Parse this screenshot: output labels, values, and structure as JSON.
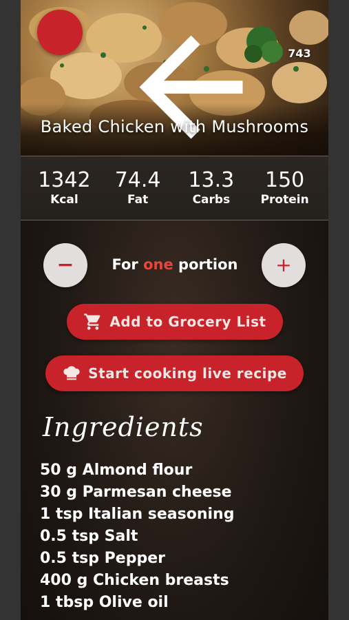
{
  "recipe": {
    "title": "Baked Chicken with Mushrooms",
    "likes": "743"
  },
  "icons": {
    "back": "arrow-left-icon",
    "favorite": "heart-icon",
    "cart": "cart-icon",
    "chef": "chef-hat-icon"
  },
  "nutrition": [
    {
      "value": "1342",
      "label": "Kcal"
    },
    {
      "value": "74.4",
      "label": "Fat"
    },
    {
      "value": "13.3",
      "label": "Carbs"
    },
    {
      "value": "150",
      "label": "Protein"
    }
  ],
  "portion": {
    "prefix": "For",
    "count": "one",
    "suffix": "portion",
    "minus": "−",
    "plus": "+"
  },
  "actions": {
    "grocery": "Add to Grocery List",
    "cook": "Start cooking live recipe"
  },
  "ingredients": {
    "heading": "Ingredients",
    "items": [
      "50 g Almond flour",
      "30 g Parmesan cheese",
      "1 tsp Italian seasoning",
      "0.5 tsp Salt",
      "0.5 tsp Pepper",
      "400 g Chicken breasts",
      "1 tbsp Olive oil"
    ]
  },
  "colors": {
    "accent": "#c8232a",
    "highlight": "#e8453c"
  }
}
